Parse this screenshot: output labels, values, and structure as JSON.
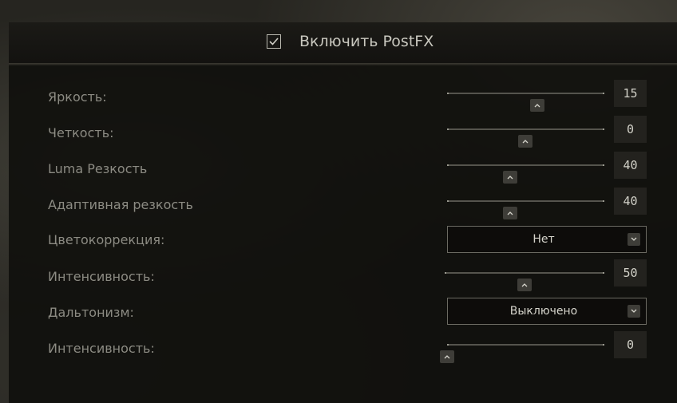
{
  "postfx": {
    "label": "Включить PostFX",
    "checked": true
  },
  "rows": [
    {
      "label": "Яркость:",
      "type": "slider",
      "value": "15"
    },
    {
      "label": "Четкость:",
      "type": "slider",
      "value": "0"
    },
    {
      "label": "Luma Резкость",
      "type": "slider",
      "value": "40"
    },
    {
      "label": "Адаптивная резкость",
      "type": "slider",
      "value": "40"
    },
    {
      "label": "Цветокоррекция:",
      "type": "dropdown",
      "value": "Нет"
    },
    {
      "label": "Интенсивность:",
      "type": "slider",
      "value": "50"
    },
    {
      "label": "Дальтонизм:",
      "type": "dropdown",
      "value": "Выключено"
    },
    {
      "label": "Интенсивность:",
      "type": "slider",
      "value": "0"
    }
  ],
  "icons": {
    "checkbox": "checkmark-icon",
    "slider_thumb": "chevron-up-icon",
    "dropdown_arrow": "chevron-down-icon"
  },
  "colors": {
    "text": "#8c8b83",
    "value_text": "#d2d1c8",
    "panel": "#100f0c"
  }
}
